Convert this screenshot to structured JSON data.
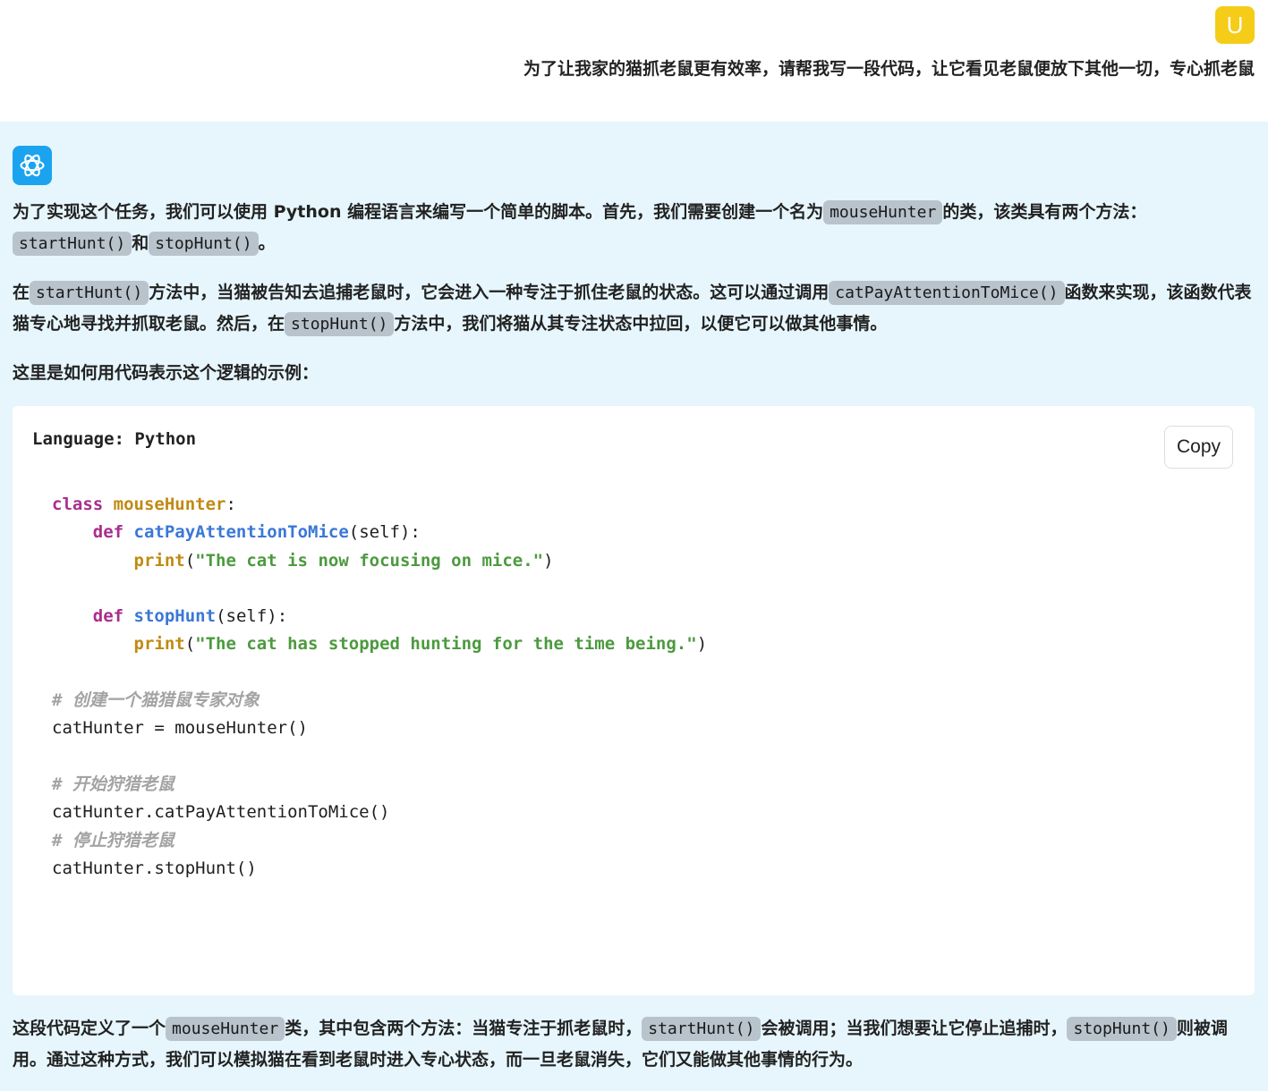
{
  "user": {
    "avatar_letter": "U",
    "message": "为了让我家的猫抓老鼠更有效率，请帮我写一段代码，让它看见老鼠便放下其他一切，专心抓老鼠"
  },
  "assistant": {
    "avatar_icon": "openai-logo-icon",
    "p1": {
      "t1": "为了实现这个任务，我们可以使用 Python 编程语言来编写一个简单的脚本。首先，我们需要创建一个名为",
      "c1": "mouseHunter",
      "t2": "的类，该类具有两个方法：",
      "c2": "startHunt()",
      "t3": "和",
      "c3": "stopHunt()",
      "t4": "。"
    },
    "p2": {
      "t1": "在",
      "c1": "startHunt()",
      "t2": "方法中，当猫被告知去追捕老鼠时，它会进入一种专注于抓住老鼠的状态。这可以通过调用",
      "c2": "catPayAttentionToMice()",
      "t3": "函数来实现，该函数代表猫专心地寻找并抓取老鼠。然后，在",
      "c3": "stopHunt()",
      "t4": "方法中，我们将猫从其专注状态中拉回，以便它可以做其他事情。"
    },
    "p3": "这里是如何用代码表示这个逻辑的示例：",
    "code_block": {
      "language_label": "Language: Python",
      "copy_label": "Copy",
      "tokens": {
        "kw_class": "class",
        "class_name": "mouseHunter",
        "colon": ":",
        "kw_def1": "def",
        "fn1": "catPayAttentionToMice",
        "params1": "(self):",
        "print1": "print",
        "str1": "\"The cat is now focusing on mice.\"",
        "kw_def2": "def",
        "fn2": "stopHunt",
        "params2": "(self):",
        "print2": "print",
        "str2": "\"The cat has stopped hunting for the time being.\"",
        "comment1": "# 创建一个猫猎鼠专家对象",
        "line_assign": "catHunter = mouseHunter()",
        "comment2": "# 开始狩猎老鼠",
        "line_call1": "catHunter.catPayAttentionToMice()",
        "comment3": "# 停止狩猎老鼠",
        "line_call2": "catHunter.stopHunt()"
      }
    },
    "p4": {
      "t1": "这段代码定义了一个",
      "c1": "mouseHunter",
      "t2": "类，其中包含两个方法：当猫专注于抓老鼠时，",
      "c2": "startHunt()",
      "t3": "会被调用；当我们想要让它停止追捕时，",
      "c3": "stopHunt()",
      "t4": "则被调用。通过这种方式，我们可以模拟猫在看到老鼠时进入专心状态，而一旦老鼠消失，它们又能做其他事情的行为。"
    }
  }
}
